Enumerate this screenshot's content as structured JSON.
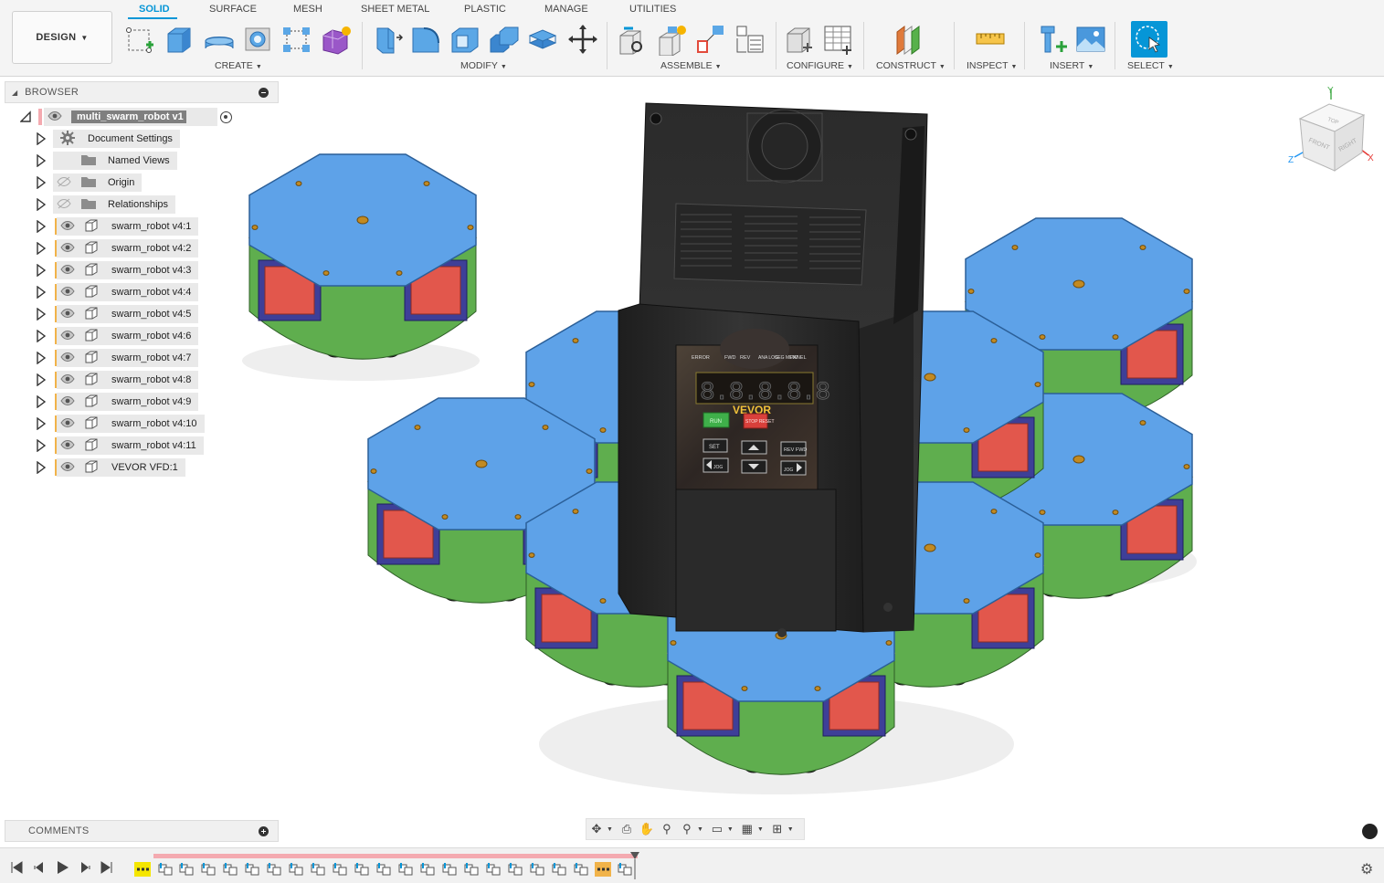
{
  "toolbar": {
    "workspace_button": "DESIGN",
    "tabs": [
      "SOLID",
      "SURFACE",
      "MESH",
      "SHEET METAL",
      "PLASTIC",
      "MANAGE",
      "UTILITIES"
    ],
    "active_tab": "SOLID",
    "groups": [
      "CREATE",
      "MODIFY",
      "ASSEMBLE",
      "CONFIGURE",
      "CONSTRUCT",
      "INSPECT",
      "INSERT",
      "SELECT"
    ],
    "accent_color": "#0696d7"
  },
  "browser": {
    "title": "BROWSER",
    "root": "multi_swarm_robot v1",
    "items": [
      {
        "label": "Document Settings",
        "icon": "gear-icon"
      },
      {
        "label": "Named Views",
        "icon": "folder-icon"
      },
      {
        "label": "Origin",
        "icon": "folder-icon",
        "hidden": true
      },
      {
        "label": "Relationships",
        "icon": "folder-icon",
        "hidden": true
      },
      {
        "label": "swarm_robot v4:1",
        "icon": "component-icon"
      },
      {
        "label": "swarm_robot v4:2",
        "icon": "component-icon"
      },
      {
        "label": "swarm_robot v4:3",
        "icon": "component-icon"
      },
      {
        "label": "swarm_robot v4:4",
        "icon": "component-icon"
      },
      {
        "label": "swarm_robot v4:5",
        "icon": "component-icon"
      },
      {
        "label": "swarm_robot v4:6",
        "icon": "component-icon"
      },
      {
        "label": "swarm_robot v4:7",
        "icon": "component-icon"
      },
      {
        "label": "swarm_robot v4:8",
        "icon": "component-icon"
      },
      {
        "label": "swarm_robot v4:9",
        "icon": "component-icon"
      },
      {
        "label": "swarm_robot v4:10",
        "icon": "component-icon"
      },
      {
        "label": "swarm_robot v4:11",
        "icon": "component-icon"
      },
      {
        "label": "VEVOR VFD:1",
        "icon": "component-icon"
      }
    ]
  },
  "comments": {
    "title": "COMMENTS"
  },
  "viewcube": {
    "faces": [
      "TOP",
      "FRONT",
      "RIGHT"
    ],
    "axes": [
      "Y",
      "Z",
      "X"
    ]
  },
  "vfd_panel": {
    "brand": "VEVOR",
    "display": "8.8.8.8.8",
    "indicators": [
      "ERROR",
      "FWD",
      "REV",
      "ANA LOG",
      "SEG MENT",
      "PANEL"
    ],
    "buttons": [
      "RUN",
      "STOP RESET",
      "SET",
      "REV FWD",
      "JOG"
    ]
  },
  "colors": {
    "robot_top": "#5ea2e8",
    "robot_side": "#5fae4e",
    "robot_panel": "#e2574c",
    "robot_band": "#e7b43c",
    "robot_frame": "#3e3f98",
    "vfd_body": "#2a2a2a",
    "timeline_track": "#f4aab0",
    "browser_marker": "#f1b34a"
  }
}
